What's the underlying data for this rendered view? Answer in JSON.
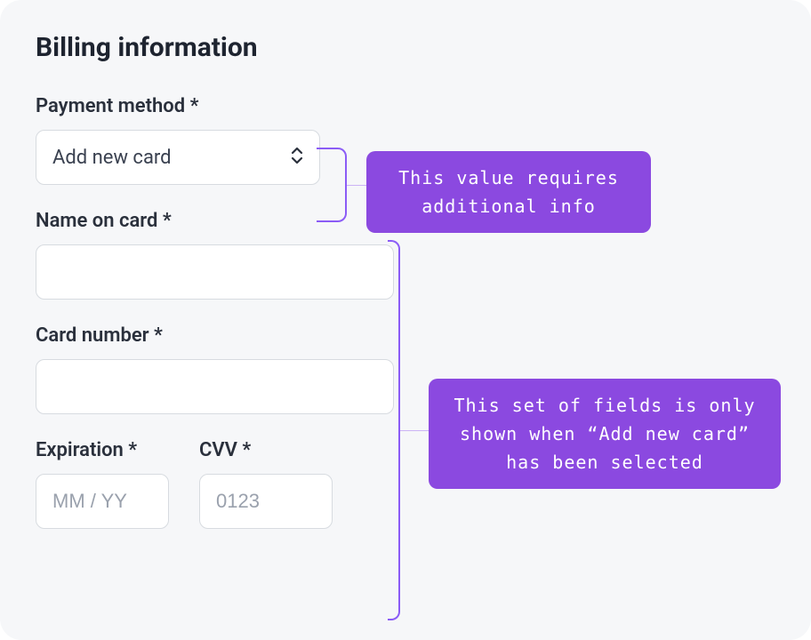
{
  "title": "Billing information",
  "paymentMethod": {
    "label": "Payment method *",
    "value": "Add new card"
  },
  "nameOnCard": {
    "label": "Name on card *",
    "value": ""
  },
  "cardNumber": {
    "label": "Card number *",
    "value": ""
  },
  "expiration": {
    "label": "Expiration *",
    "placeholder": "MM / YY",
    "value": ""
  },
  "cvv": {
    "label": "CVV *",
    "placeholder": "0123",
    "value": ""
  },
  "annotations": {
    "requiresInfo": "This value requires additional info",
    "conditionalFields": "This set of fields is only shown when “Add new card” has been selected"
  },
  "colors": {
    "callout": "#8b49e0",
    "bracket": "#8b5cf6",
    "cardBg": "#f6f7f9",
    "border": "#d7dbe0"
  }
}
